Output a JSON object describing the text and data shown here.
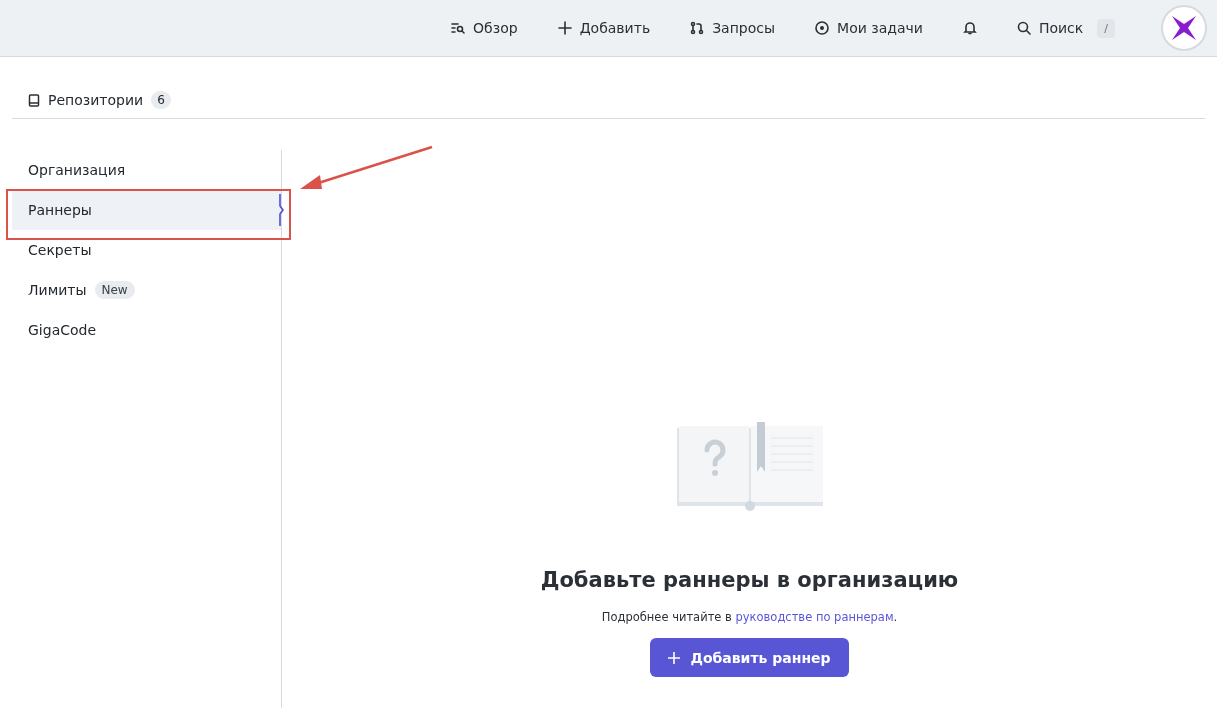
{
  "header": {
    "nav": [
      {
        "kind": "overview",
        "label": "Обзор"
      },
      {
        "kind": "add",
        "label": "Добавить"
      },
      {
        "kind": "requests",
        "label": "Запросы"
      },
      {
        "kind": "tasks",
        "label": "Мои задачи"
      },
      {
        "kind": "bell"
      }
    ],
    "search": {
      "label": "Поиск",
      "shortcut": "/"
    }
  },
  "repos_tab": {
    "label": "Репозитории",
    "count": "6"
  },
  "sidebar": {
    "items": [
      {
        "label": "Организация",
        "selected": false
      },
      {
        "label": "Раннеры",
        "selected": true
      },
      {
        "label": "Секреты",
        "selected": false
      },
      {
        "label": "Лимиты",
        "selected": false,
        "badge": "New"
      },
      {
        "label": "GigaCode",
        "selected": false
      }
    ]
  },
  "empty_state": {
    "title": "Добавьте раннеры в организацию",
    "text_before": "Подробнее читайте в ",
    "link": "руководстве по раннерам",
    "text_after": ".",
    "button": "Добавить раннер"
  },
  "annotation": {
    "highlight": true
  }
}
